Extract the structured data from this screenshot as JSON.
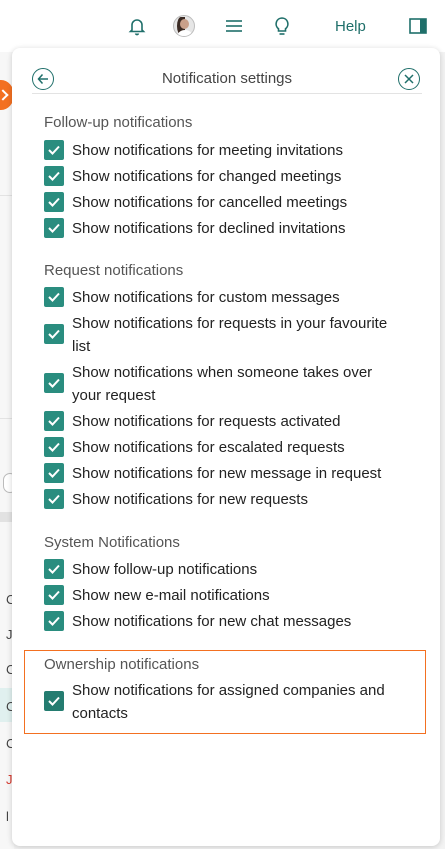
{
  "topbar": {
    "icons": [
      "bell-icon",
      "avatar",
      "menu-icon",
      "lightbulb-icon"
    ],
    "help_label": "Help",
    "panel_toggle_icon": "sidebar-panel-icon"
  },
  "background": {
    "letters": [
      "C",
      "J",
      "C",
      "C",
      "C",
      "J",
      "l"
    ]
  },
  "panel": {
    "title": "Notification settings",
    "back_icon": "arrow-left-icon",
    "close_icon": "close-icon",
    "accent_color": "#2a8d7f",
    "highlight_color": "#f37021",
    "sections": [
      {
        "title": "Follow-up notifications",
        "items": [
          {
            "label": "Show notifications for meeting invitations",
            "checked": true
          },
          {
            "label": "Show notifications for changed meetings",
            "checked": true
          },
          {
            "label": "Show notifications for cancelled meetings",
            "checked": true
          },
          {
            "label": "Show notifications for declined invitations",
            "checked": true
          }
        ]
      },
      {
        "title": "Request notifications",
        "items": [
          {
            "label": "Show notifications for custom messages",
            "checked": true
          },
          {
            "label": "Show notifications for requests in your favourite list",
            "checked": true
          },
          {
            "label": "Show notifications when someone takes over your request",
            "checked": true
          },
          {
            "label": "Show notifications for requests activated",
            "checked": true
          },
          {
            "label": "Show notifications for escalated requests",
            "checked": true
          },
          {
            "label": "Show notifications for new message in request",
            "checked": true
          },
          {
            "label": "Show notifications for new requests",
            "checked": true
          }
        ]
      },
      {
        "title": "System Notifications",
        "items": [
          {
            "label": "Show follow-up notifications",
            "checked": true
          },
          {
            "label": "Show new e-mail notifications",
            "checked": true
          },
          {
            "label": "Show notifications for new chat messages",
            "checked": true
          }
        ]
      },
      {
        "title": "Ownership notifications",
        "items": [
          {
            "label": "Show notifications for assigned companies and contacts",
            "checked": true
          }
        ]
      }
    ]
  }
}
